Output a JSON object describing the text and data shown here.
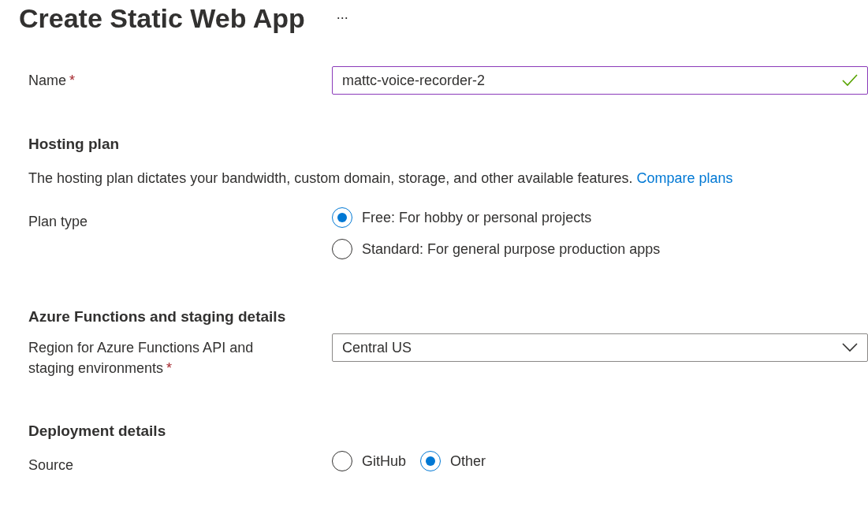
{
  "header": {
    "title": "Create Static Web App",
    "more": "..."
  },
  "name_field": {
    "label": "Name",
    "required_mark": "*",
    "value": "mattc-voice-recorder-2",
    "valid": true
  },
  "hosting_plan": {
    "heading": "Hosting plan",
    "description": "The hosting plan dictates your bandwidth, custom domain, storage, and other available features.",
    "link": "Compare plans",
    "plan_type": {
      "label": "Plan type",
      "options": [
        {
          "label": "Free: For hobby or personal projects",
          "selected": true
        },
        {
          "label": "Standard: For general purpose production apps",
          "selected": false
        }
      ]
    }
  },
  "functions": {
    "heading": "Azure Functions and staging details",
    "region": {
      "label": "Region for Azure Functions API and staging environments",
      "required_mark": "*",
      "value": "Central US"
    }
  },
  "deployment": {
    "heading": "Deployment details",
    "source": {
      "label": "Source",
      "options": [
        {
          "label": "GitHub",
          "selected": false
        },
        {
          "label": "Other",
          "selected": true
        }
      ]
    }
  }
}
